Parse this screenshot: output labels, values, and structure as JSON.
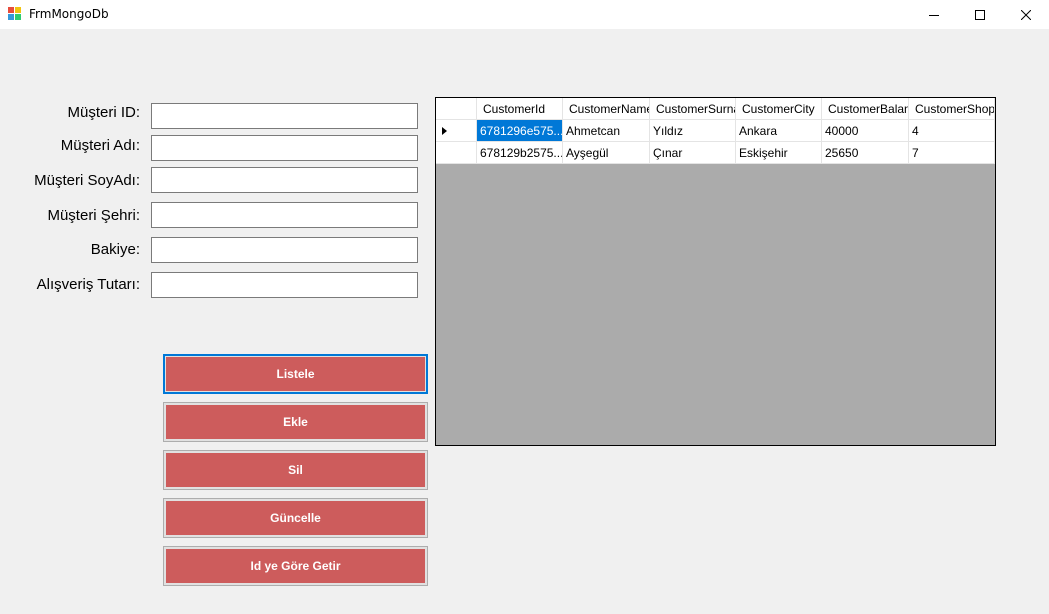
{
  "window": {
    "title": "FrmMongoDb"
  },
  "form": {
    "fields": [
      {
        "label": "Müşteri ID:",
        "value": ""
      },
      {
        "label": "Müşteri Adı:",
        "value": ""
      },
      {
        "label": "Müşteri SoyAdı:",
        "value": ""
      },
      {
        "label": "Müşteri Şehri:",
        "value": ""
      },
      {
        "label": "Bakiye:",
        "value": ""
      },
      {
        "label": "Alışveriş Tutarı:",
        "value": ""
      }
    ],
    "buttons": [
      {
        "label": "Listele"
      },
      {
        "label": "Ekle"
      },
      {
        "label": "Sil"
      },
      {
        "label": "Güncelle"
      },
      {
        "label": "Id ye Göre Getir"
      }
    ]
  },
  "grid": {
    "columns": [
      "CustomerId",
      "CustomerName",
      "CustomerSurname",
      "CustomerCity",
      "CustomerBalance",
      "CustomerShopping"
    ],
    "rows": [
      [
        "6781296e575...",
        "Ahmetcan",
        "Yıldız",
        "Ankara",
        "40000",
        "4"
      ],
      [
        "678129b2575...",
        "Ayşegül",
        "Çınar",
        "Eskişehir",
        "25650",
        "7"
      ]
    ]
  },
  "colors": {
    "button_face": "#cd5c5c",
    "selection": "#0078d7",
    "grid_background": "#ababab"
  }
}
